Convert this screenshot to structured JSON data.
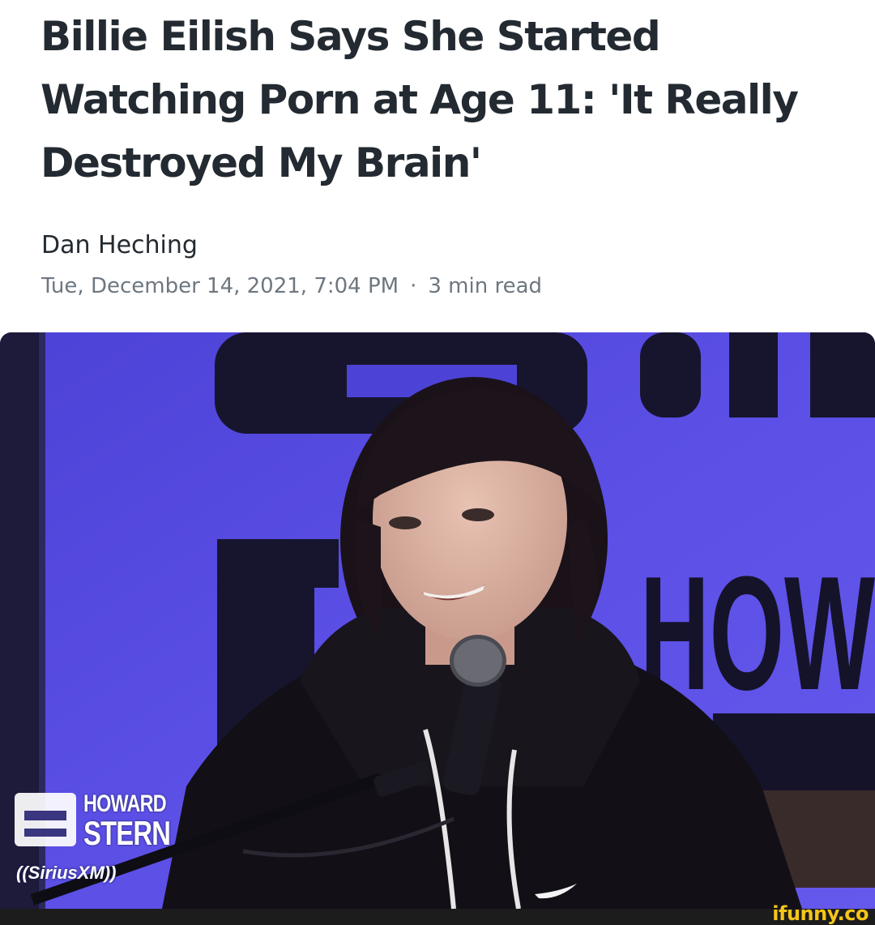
{
  "article": {
    "headline": "Billie Eilish Says She Started Watching Porn at Age 11: 'It Really Destroyed My Brain'",
    "author": "Dan Heching",
    "date": "Tue, December 14, 2021, 7:04 PM",
    "separator": "·",
    "read_time": "3 min read"
  },
  "image": {
    "logo": {
      "line1": "HOWARD",
      "line2": "STERN",
      "line3": "((SiriusXM))"
    },
    "background_color": "#5a4ee0"
  },
  "watermark": {
    "text": "ifunny.co",
    "color": "#f5c518"
  }
}
